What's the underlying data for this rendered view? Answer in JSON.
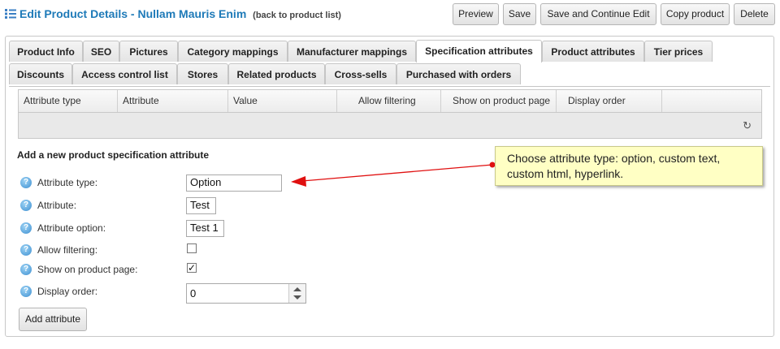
{
  "header": {
    "title": "Edit Product Details - Nullam Mauris Enim",
    "back_link": "(back to product list)",
    "buttons": {
      "preview": "Preview",
      "save": "Save",
      "save_continue": "Save and Continue Edit",
      "copy": "Copy product",
      "delete": "Delete"
    }
  },
  "tabs": {
    "row1": [
      "Product Info",
      "SEO",
      "Pictures",
      "Category mappings",
      "Manufacturer mappings",
      "Specification attributes",
      "Product attributes",
      "Tier prices"
    ],
    "row2": [
      "Discounts",
      "Access control list",
      "Stores",
      "Related products",
      "Cross-sells",
      "Purchased with orders"
    ],
    "active": "Specification attributes"
  },
  "grid": {
    "columns": [
      "Attribute type",
      "Attribute",
      "Value",
      "Allow filtering",
      "Show on product page",
      "Display order"
    ],
    "refresh_icon": "refresh-icon"
  },
  "form": {
    "section_title": "Add a new product specification attribute",
    "help_icon_glyph": "?",
    "attribute_type": {
      "label": "Attribute type:",
      "value": "Option"
    },
    "attribute": {
      "label": "Attribute:",
      "value": "Test"
    },
    "attribute_option": {
      "label": "Attribute option:",
      "value": "Test 1"
    },
    "allow_filtering": {
      "label": "Allow filtering:",
      "checked": false
    },
    "show_on_product_page": {
      "label": "Show on product page:",
      "checked": true,
      "check_glyph": "✓"
    },
    "display_order": {
      "label": "Display order:",
      "value": "0"
    },
    "add_button": "Add attribute"
  },
  "callout": {
    "text": "Choose attribute type: option, custom text, custom html, hyperlink.",
    "arrow_color": "#e01010"
  },
  "colors": {
    "title": "#1e7ab8",
    "help_icon": "#3d8fd1",
    "callout_bg": "#ffffc4"
  }
}
